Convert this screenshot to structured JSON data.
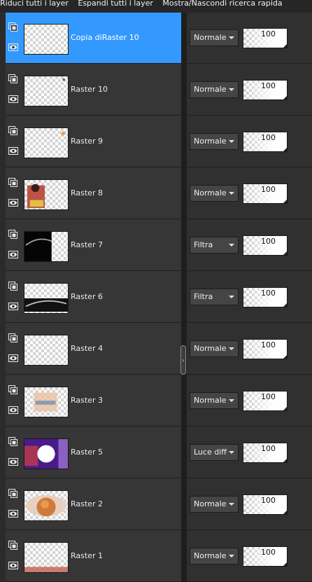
{
  "toolbar": {
    "collapse_all": "Riduci tutti i layer",
    "expand_all": "Espandi tutti i layer",
    "toggle_search": "Mostra/Nascondi ricerca rapida"
  },
  "icons": {
    "layer_type": "raster-layer-icon",
    "visibility": "eye-icon",
    "dropdown": "chevron-down-icon",
    "splitter": "chevron-right-icon"
  },
  "colors": {
    "selected_row": "#3399ff",
    "panel": "#363636",
    "background": "#2b2b2b"
  },
  "layers": [
    {
      "name": "Copia diRaster 10",
      "blend": "Normale",
      "opacity": "100",
      "selected": true
    },
    {
      "name": "Raster 10",
      "blend": "Normale",
      "opacity": "100",
      "selected": false
    },
    {
      "name": "Raster 9",
      "blend": "Normale",
      "opacity": "100",
      "selected": false
    },
    {
      "name": "Raster 8",
      "blend": "Normale",
      "opacity": "100",
      "selected": false
    },
    {
      "name": "Raster 7",
      "blend": "Filtra",
      "opacity": "100",
      "selected": false
    },
    {
      "name": "Raster 6",
      "blend": "Filtra",
      "opacity": "100",
      "selected": false
    },
    {
      "name": "Raster 4",
      "blend": "Normale",
      "opacity": "100",
      "selected": false
    },
    {
      "name": "Raster 3",
      "blend": "Normale",
      "opacity": "100",
      "selected": false
    },
    {
      "name": "Raster 5",
      "blend": "Luce diffusa",
      "opacity": "100",
      "selected": false
    },
    {
      "name": "Raster 2",
      "blend": "Normale",
      "opacity": "100",
      "selected": false
    },
    {
      "name": "Raster 1",
      "blend": "Normale",
      "opacity": "100",
      "selected": false
    }
  ]
}
